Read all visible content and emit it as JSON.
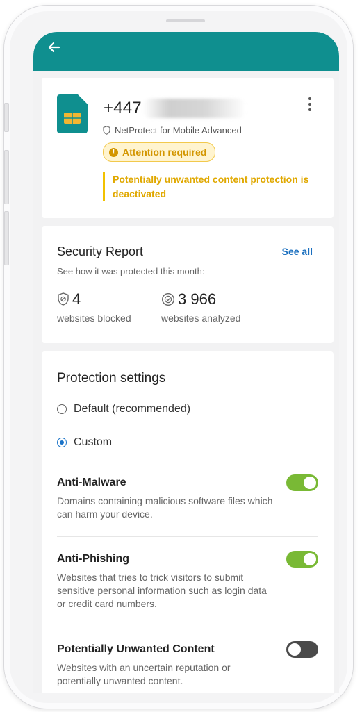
{
  "header": {
    "back_icon": "arrow-left-icon"
  },
  "device": {
    "number_prefix": "+447",
    "product": "NetProtect for Mobile Advanced",
    "attention_label": "Attention required",
    "warning_text": "Potentially unwanted content protection is deactivated"
  },
  "security_report": {
    "title": "Security Report",
    "see_all": "See all",
    "subtitle": "See how it was protected this month:",
    "blocked_value": "4",
    "blocked_label": "websites blocked",
    "analyzed_value": "3 966",
    "analyzed_label": "websites analyzed"
  },
  "protection": {
    "title": "Protection settings",
    "options": [
      {
        "label": "Default (recommended)",
        "selected": false
      },
      {
        "label": "Custom",
        "selected": true
      }
    ],
    "settings": [
      {
        "title": "Anti-Malware",
        "description": "Domains containing malicious software files which can harm your device.",
        "enabled": true
      },
      {
        "title": "Anti-Phishing",
        "description": "Websites that tries to trick visitors to submit sensitive personal information such as login data or credit card numbers.",
        "enabled": true
      },
      {
        "title": "Potentially Unwanted Content",
        "description": "Websites with an uncertain reputation or potentially unwanted content.",
        "enabled": false
      }
    ]
  },
  "colors": {
    "appbar": "#0f8f8f",
    "toggle_on": "#79b935",
    "toggle_off": "#4a4a4a",
    "warning": "#e0a800",
    "link": "#1a6fbf"
  }
}
